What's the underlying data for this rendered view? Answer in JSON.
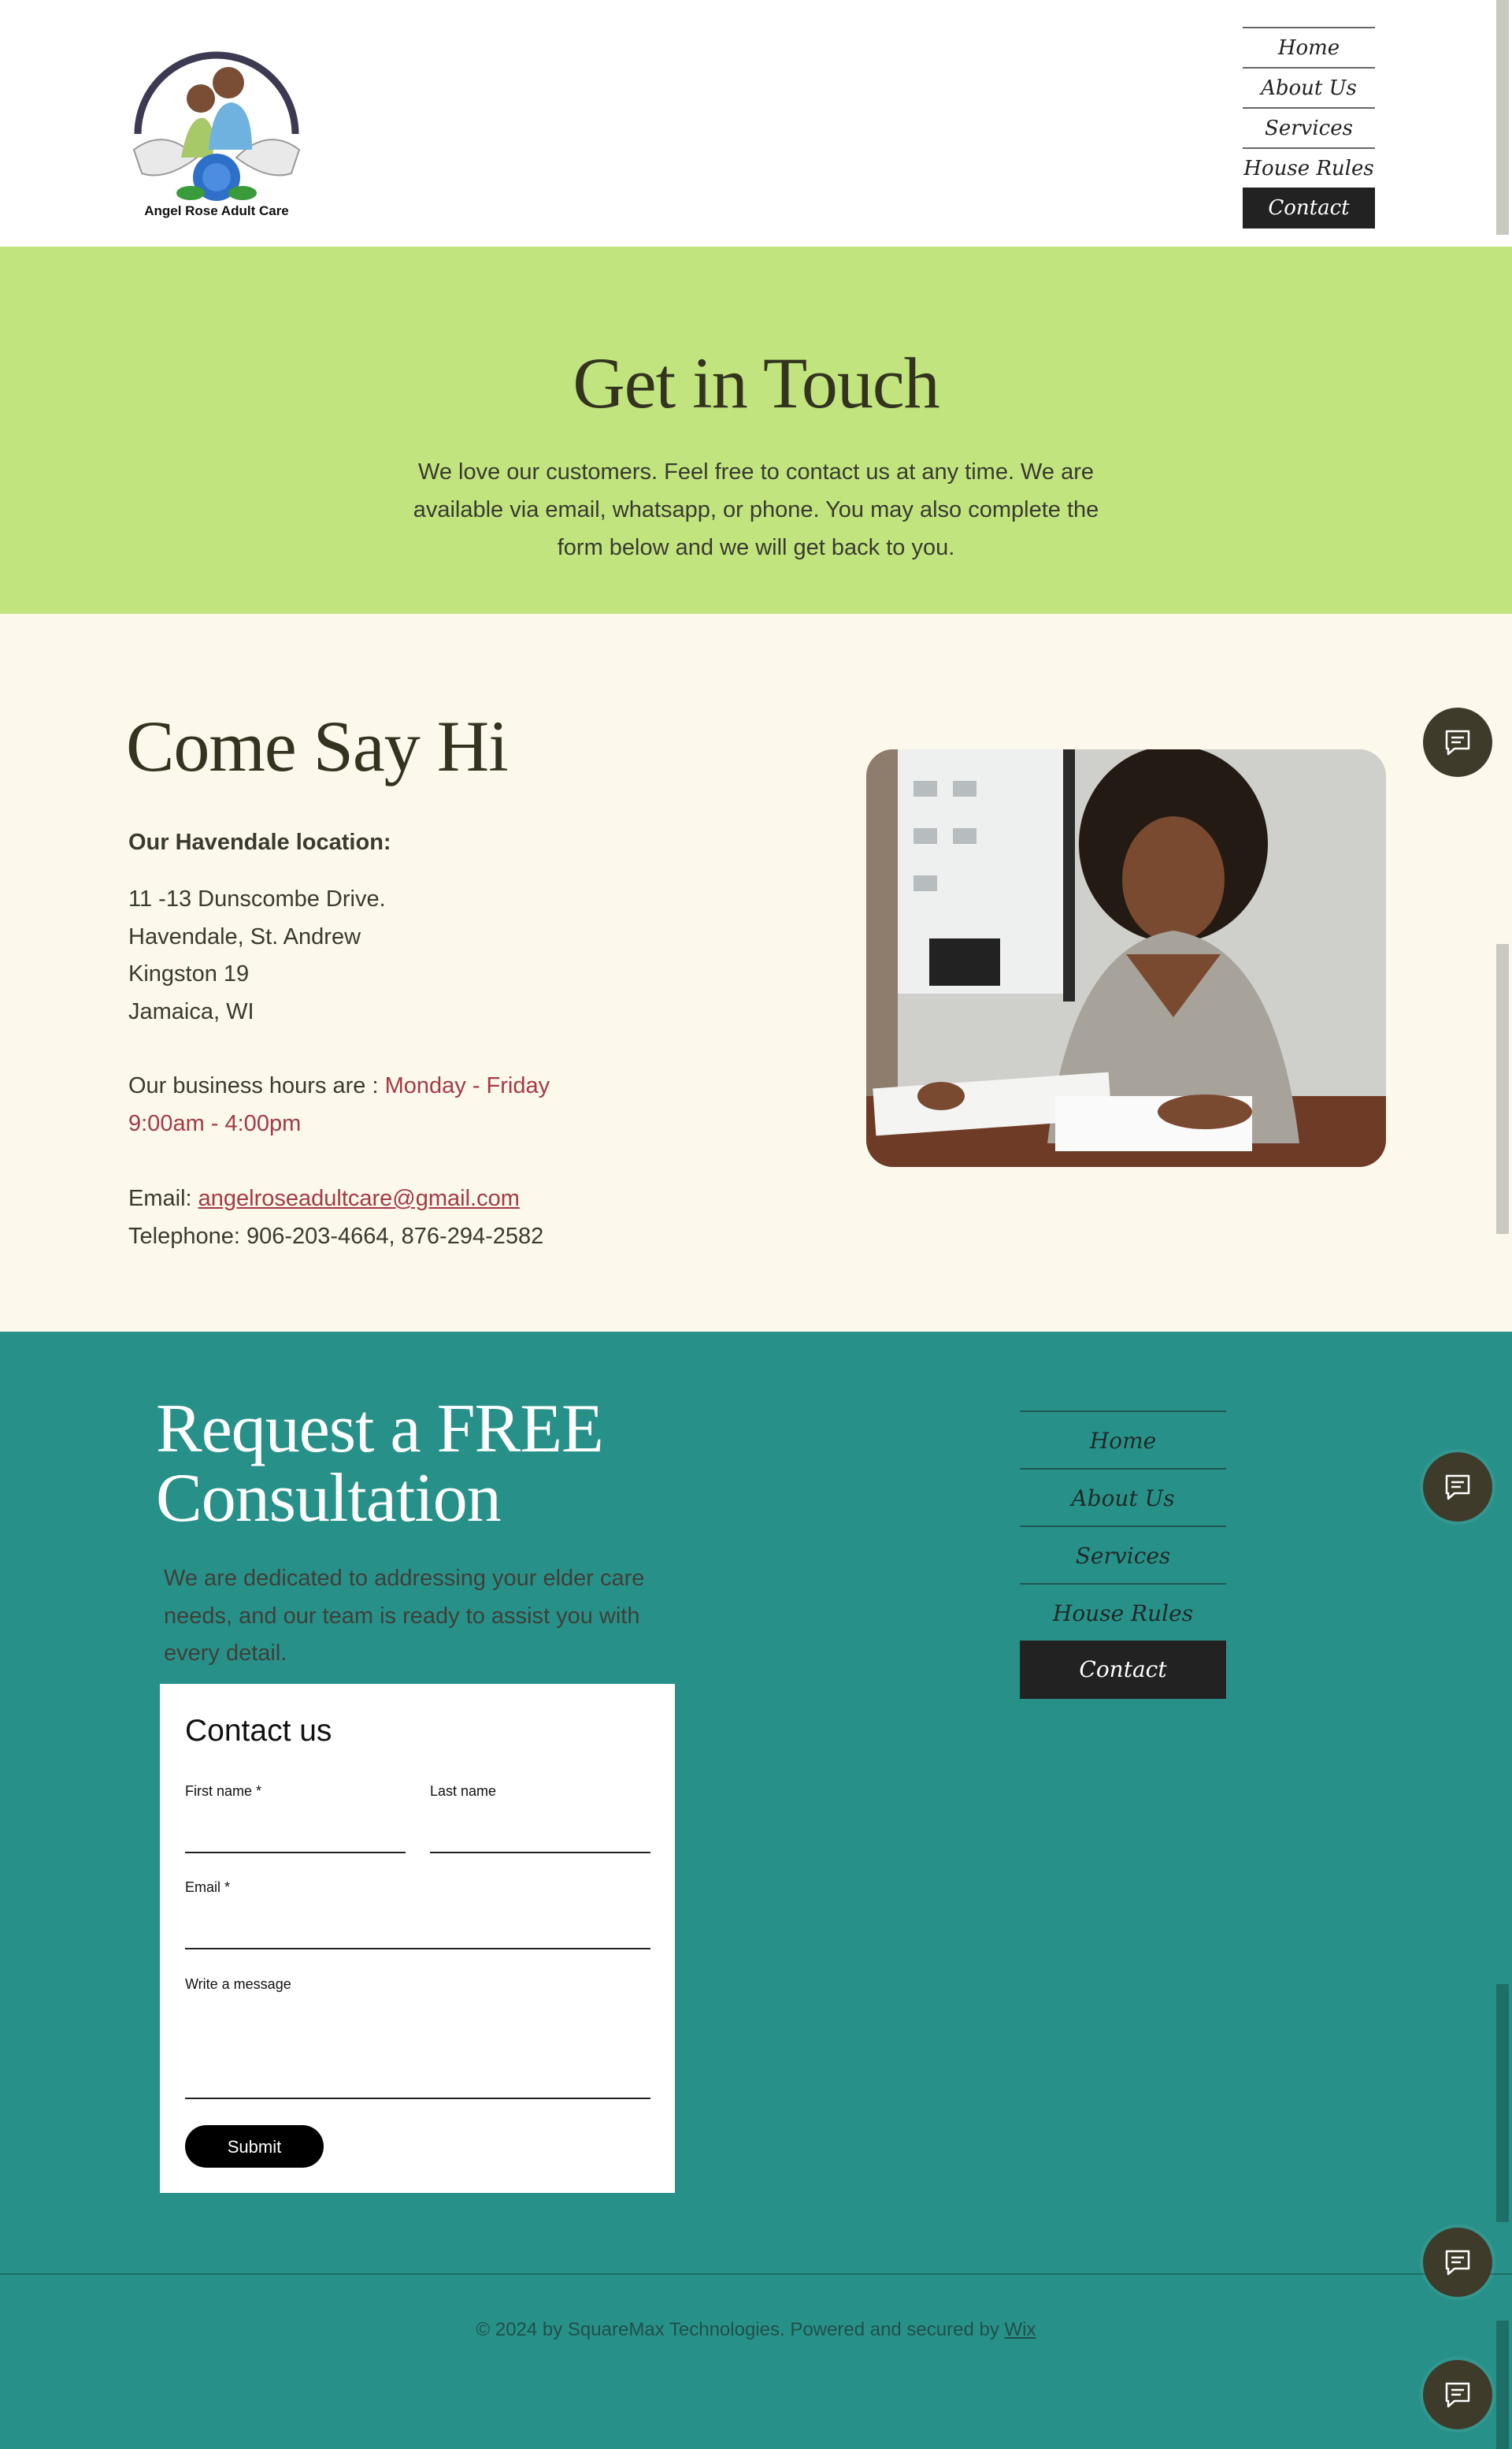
{
  "header": {
    "logo_text": "Angel Rose Adult Care",
    "nav": [
      {
        "label": "Home"
      },
      {
        "label": "About Us"
      },
      {
        "label": "Services"
      },
      {
        "label": "House Rules"
      },
      {
        "label": "Contact"
      }
    ],
    "active_nav": "Contact"
  },
  "hero": {
    "title": "Get in Touch",
    "text": "We love our customers. Feel free to contact us at any time. We are available via email, whatsapp, or phone.  You may also complete the form below and we will get back to you."
  },
  "say_hi": {
    "title": "Come Say Hi",
    "location_heading": "Our Havendale location:",
    "address": [
      "11 -13 Dunscombe Drive.",
      "Havendale, St. Andrew",
      "Kingston 19",
      "Jamaica, WI"
    ],
    "hours_prefix": "Our business hours are : ",
    "hours_days": "Monday - Friday",
    "hours_time": "9:00am - 4:00pm",
    "email_label": "Email: ",
    "email": "angelroseadultcare@gmail.com",
    "telephone": "Telephone: 906-203-4664, 876-294-2582"
  },
  "consultation": {
    "title_line1": "Request a FREE",
    "title_line2": "Consultation",
    "intro": "We are dedicated to addressing your elder care needs, and our team is ready to assist you with every detail.",
    "form": {
      "title": "Contact us",
      "first_name_label": "First name *",
      "last_name_label": "Last name",
      "email_label": "Email *",
      "message_label": "Write a message",
      "submit_label": "Submit"
    },
    "nav": [
      {
        "label": "Home"
      },
      {
        "label": "About Us"
      },
      {
        "label": "Services"
      },
      {
        "label": "House Rules"
      },
      {
        "label": "Contact"
      }
    ]
  },
  "footer": {
    "copyright": "© 2024 by SquareMax Technologies. Powered and secured by ",
    "wix_link": "Wix"
  },
  "colors": {
    "hero_bg": "#c1e47e",
    "section_bg": "#fcf8ec",
    "teal_bg": "#279189",
    "accent_red": "#a33a46",
    "chat_button": "#3f3b2b"
  },
  "icons": [
    "chat-icon"
  ]
}
